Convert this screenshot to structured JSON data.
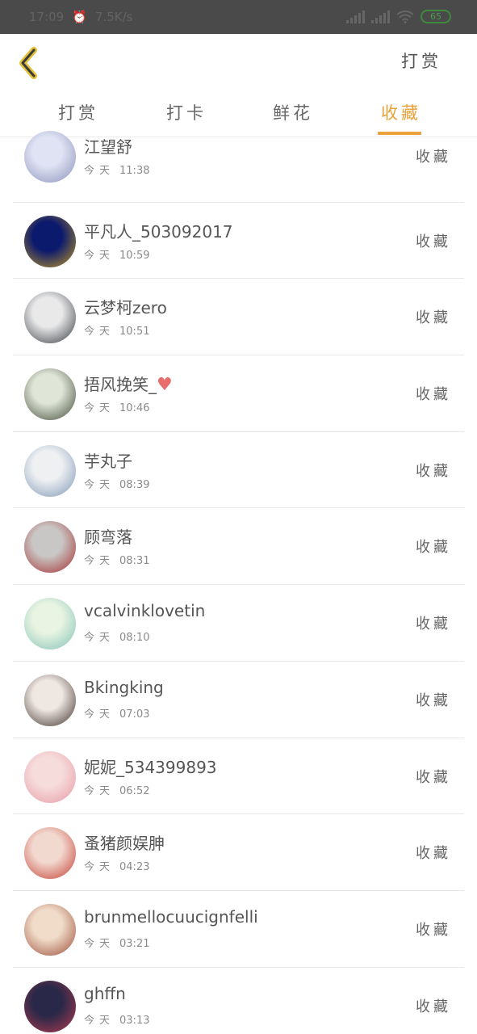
{
  "status_bar": {
    "time": "17:09",
    "speed": "7.5K/s",
    "battery": "65"
  },
  "nav": {
    "action_label": "打赏"
  },
  "tabs": [
    {
      "label": "打赏",
      "active": false
    },
    {
      "label": "打卡",
      "active": false
    },
    {
      "label": "鲜花",
      "active": false
    },
    {
      "label": "收藏",
      "active": true
    }
  ],
  "accent_color": "#eba23c",
  "day_label": "今天",
  "action_label": "收藏",
  "items": [
    {
      "name": "江望舒",
      "time": "11:38",
      "avatar_colors": [
        "#dfe3f4",
        "#8a90b8"
      ]
    },
    {
      "name": "平凡人_503092017",
      "time": "10:59",
      "avatar_colors": [
        "#0c1a6e",
        "#c29a22"
      ]
    },
    {
      "name": "云梦柯zero",
      "time": "10:51",
      "avatar_colors": [
        "#e9e9ea",
        "#33383d"
      ]
    },
    {
      "name": "捂风挽笑_",
      "time": "10:46",
      "avatar_colors": [
        "#dfe6d8",
        "#3d4533"
      ],
      "heart": true
    },
    {
      "name": "芋丸子",
      "time": "08:39",
      "avatar_colors": [
        "#eef0f2",
        "#7b95b5"
      ]
    },
    {
      "name": "顾弯落",
      "time": "08:31",
      "avatar_colors": [
        "#c9c7c6",
        "#a32a2a"
      ]
    },
    {
      "name": "vcalvinklovetin",
      "time": "08:10",
      "avatar_colors": [
        "#e9f4e2",
        "#7fc1b7"
      ]
    },
    {
      "name": "Bkingking",
      "time": "07:03",
      "avatar_colors": [
        "#efe7e2",
        "#3b2c26"
      ]
    },
    {
      "name": "妮妮_534399893",
      "time": "06:52",
      "avatar_colors": [
        "#f7dcdc",
        "#e39aa3"
      ]
    },
    {
      "name": "蚤猪颜娱胂",
      "time": "04:23",
      "avatar_colors": [
        "#f2d9d0",
        "#c43a2e"
      ]
    },
    {
      "name": "brunmellocuucignfelli",
      "time": "03:21",
      "avatar_colors": [
        "#f0dcc9",
        "#9a4a36"
      ]
    },
    {
      "name": "ghffn",
      "time": "03:13",
      "avatar_colors": [
        "#2a2848",
        "#b43b50"
      ]
    }
  ]
}
